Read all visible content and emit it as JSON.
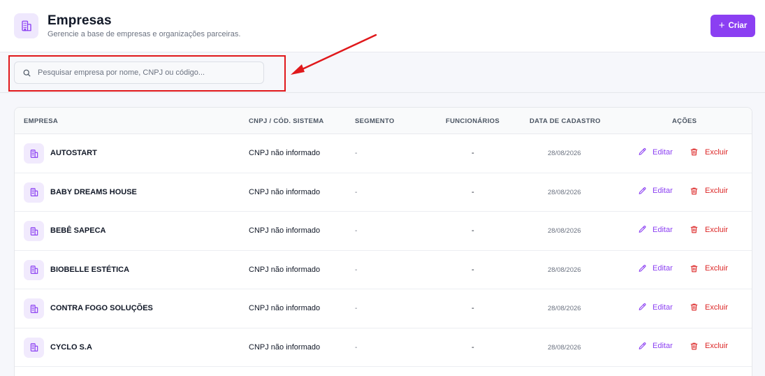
{
  "header": {
    "title": "Empresas",
    "subtitle": "Gerencie a base de empresas e organizações parceiras.",
    "icon": "building-icon",
    "create_label": "Criar"
  },
  "search": {
    "placeholder": "Pesquisar empresa por nome, CNPJ ou código...",
    "value": ""
  },
  "table": {
    "columns": [
      "EMPRESA",
      "CNPJ / CÓD. SISTEMA",
      "SEGMENTO",
      "FUNCIONÁRIOS",
      "DATA DE CADASTRO",
      "AÇÕES"
    ],
    "rows": [
      {
        "name": "AUTOSTART",
        "cnpj": "CNPJ não informado",
        "segment": "-",
        "employees": "-",
        "date": "28/08/2026",
        "edit": "Editar",
        "delete": "Excluir"
      },
      {
        "name": "BABY DREAMS HOUSE",
        "cnpj": "CNPJ não informado",
        "segment": "-",
        "employees": "-",
        "date": "28/08/2026",
        "edit": "Editar",
        "delete": "Excluir"
      },
      {
        "name": "BEBÊ SAPECA",
        "cnpj": "CNPJ não informado",
        "segment": "-",
        "employees": "-",
        "date": "28/08/2026",
        "edit": "Editar",
        "delete": "Excluir"
      },
      {
        "name": "BIOBELLE ESTÉTICA",
        "cnpj": "CNPJ não informado",
        "segment": "-",
        "employees": "-",
        "date": "28/08/2026",
        "edit": "Editar",
        "delete": "Excluir"
      },
      {
        "name": "CONTRA FOGO SOLUÇÕES",
        "cnpj": "CNPJ não informado",
        "segment": "-",
        "employees": "-",
        "date": "28/08/2026",
        "edit": "Editar",
        "delete": "Excluir"
      },
      {
        "name": "CYCLO S.A",
        "cnpj": "CNPJ não informado",
        "segment": "-",
        "employees": "-",
        "date": "28/08/2026",
        "edit": "Editar",
        "delete": "Excluir"
      }
    ]
  },
  "colors": {
    "accent": "#8b3ff2",
    "danger": "#dc2626",
    "annotation": "#e0181b"
  }
}
